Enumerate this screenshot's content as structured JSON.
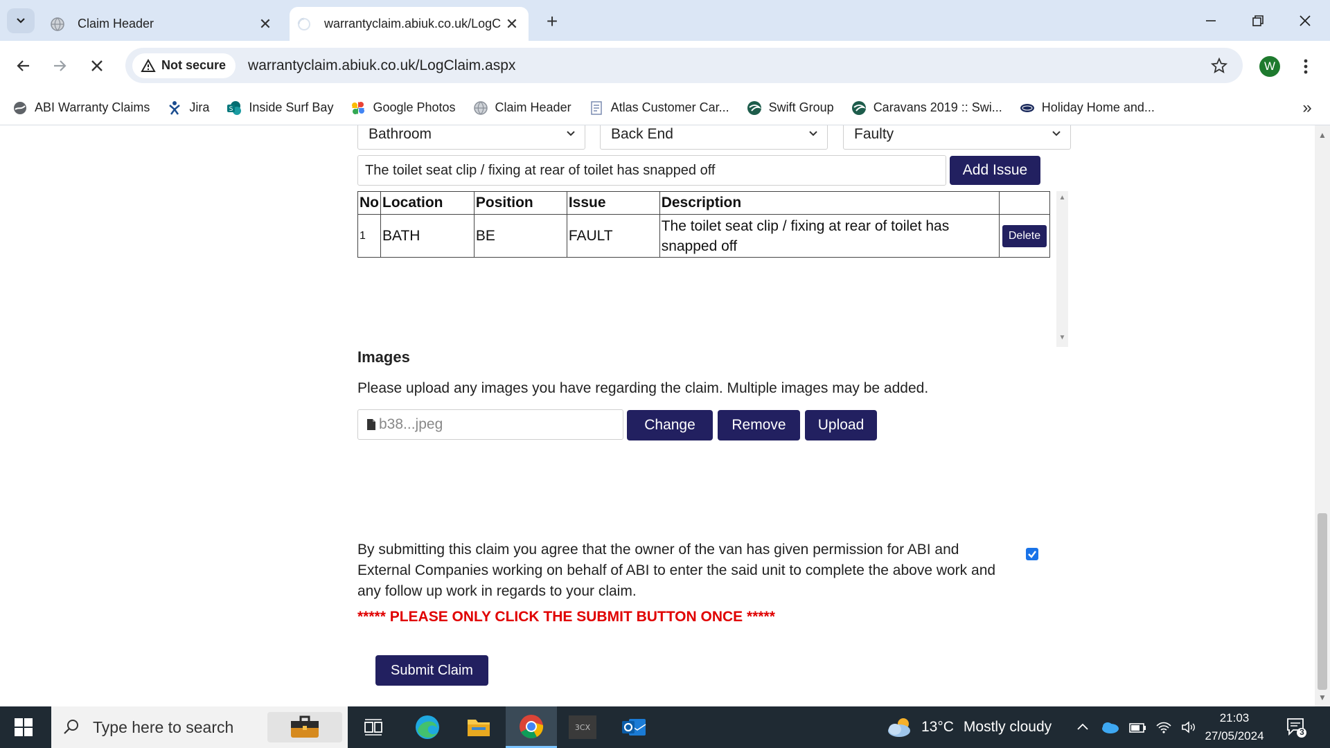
{
  "browser": {
    "tabs": [
      {
        "title": "Claim Header",
        "active": false
      },
      {
        "title": "warrantyclaim.abiuk.co.uk/LogC",
        "active": true
      }
    ],
    "security_label": "Not secure",
    "url": "warrantyclaim.abiuk.co.uk/LogClaim.aspx",
    "profile_initial": "W",
    "bookmarks": [
      {
        "label": "ABI Warranty Claims",
        "icon": "globe-icon"
      },
      {
        "label": "Jira",
        "icon": "jira-icon"
      },
      {
        "label": "Inside Surf Bay",
        "icon": "sharepoint-icon"
      },
      {
        "label": "Google Photos",
        "icon": "photos-pinwheel-icon"
      },
      {
        "label": "Claim Header",
        "icon": "globe-icon"
      },
      {
        "label": "Atlas Customer Car...",
        "icon": "document-icon"
      },
      {
        "label": "Swift Group",
        "icon": "swift-logo-icon"
      },
      {
        "label": "Caravans 2019 :: Swi...",
        "icon": "swift-logo-icon"
      },
      {
        "label": "Holiday Home and...",
        "icon": "abi-logo-icon"
      }
    ],
    "colors": {
      "tabstrip": "#dbe6f5",
      "omnibox": "#e9eef6"
    }
  },
  "form": {
    "location_select": "Bathroom",
    "position_select": "Back End",
    "issue_select": "Faulty",
    "description_value": "The toilet seat clip / fixing at rear of toilet has snapped off",
    "add_issue_label": "Add Issue",
    "table": {
      "headers": [
        "No",
        "Location",
        "Position",
        "Issue",
        "Description",
        ""
      ],
      "rows": [
        {
          "no": "1",
          "location": "BATH",
          "position": "BE",
          "issue": "FAULT",
          "description": "The toilet seat clip / fixing at rear of toilet has snapped off",
          "delete_label": "Delete"
        }
      ]
    },
    "images": {
      "heading": "Images",
      "instructions": "Please upload any images you have regarding the claim. Multiple images may be added.",
      "file_name": "b38...jpeg",
      "change_label": "Change",
      "remove_label": "Remove",
      "upload_label": "Upload"
    },
    "consent_text": "By submitting this claim you agree that the owner of the van has given permission for ABI and External Companies working on behalf of ABI to enter the said unit to complete the above work and any follow up work in regards to your claim.",
    "consent_checked": true,
    "warning": "***** PLEASE ONLY CLICK THE SUBMIT BUTTON ONCE *****",
    "submit_label": "Submit Claim",
    "colors": {
      "button": "#222060",
      "warning": "#e00000",
      "checkbox": "#1a73e8"
    }
  },
  "taskbar": {
    "search_placeholder": "Type here to search",
    "weather_temp": "13°C",
    "weather_desc": "Mostly cloudy",
    "time": "21:03",
    "date": "27/05/2024",
    "notification_count": "3",
    "apps": [
      "task-view-icon",
      "edge-icon",
      "file-explorer-icon",
      "chrome-icon",
      "3cx-icon",
      "outlook-icon"
    ]
  }
}
